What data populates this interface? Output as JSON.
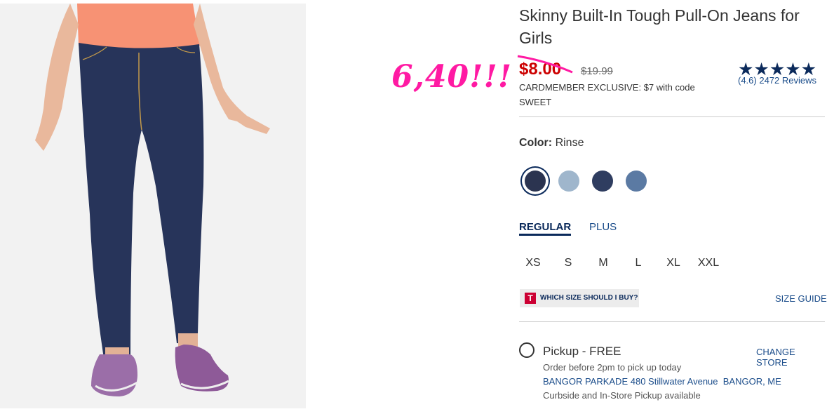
{
  "product": {
    "title": "Skinny Built-In Tough Pull-On Jeans for Girls",
    "sale_price": "$8.00",
    "original_price": "$19.99",
    "promo": "CARDMEMBER EXCLUSIVE: $7 with code SWEET",
    "rating_stars": "★★★★★",
    "rating_value": 4.6,
    "rating_text": "(4.6) 2472 Reviews"
  },
  "annotation": "6,40!!!",
  "color": {
    "label": "Color:",
    "selected": "Rinse",
    "swatches": [
      {
        "name": "Rinse",
        "hex": "#2b3450",
        "selected": true
      },
      {
        "name": "Light Wash",
        "hex": "#9fb6cc",
        "selected": false
      },
      {
        "name": "Dark Wash",
        "hex": "#2f3d60",
        "selected": false
      },
      {
        "name": "Medium Wash",
        "hex": "#5b7aa3",
        "selected": false
      }
    ]
  },
  "fit": {
    "active": "REGULAR",
    "other": "PLUS"
  },
  "sizes": [
    "XS",
    "S",
    "M",
    "L",
    "XL",
    "XXL"
  ],
  "size_help": {
    "badge": "T",
    "label": "WHICH SIZE SHOULD I BUY?",
    "guide": "SIZE GUIDE"
  },
  "pickup": {
    "label": "Pickup - FREE",
    "change": "CHANGE STORE",
    "order_note": "Order before 2pm to pick up today",
    "store": "BANGOR PARKADE 480 Stillwater Avenue  BANGOR, ME",
    "availability": "Curbside and In-Store Pickup available"
  },
  "colors": {
    "sale": "#cc0000",
    "brand_navy": "#0b2a5b",
    "link": "#1a4c8a",
    "annotation": "#ff1aa3"
  }
}
